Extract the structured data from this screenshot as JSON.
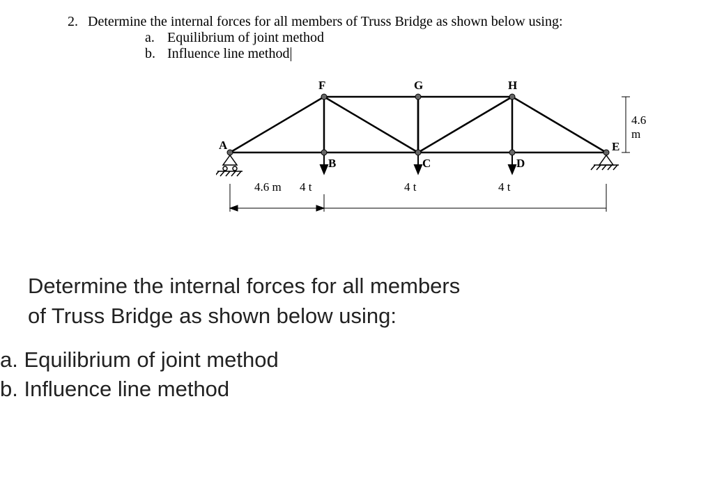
{
  "problem": {
    "number": "2.",
    "text": "Determine the internal forces for all members of Truss Bridge as shown below using:",
    "sub_a_letter": "a.",
    "sub_a_text": "Equilibrium of joint method",
    "sub_b_letter": "b.",
    "sub_b_text": "Influence line method"
  },
  "truss": {
    "nodes": {
      "A": "A",
      "B": "B",
      "C": "C",
      "D": "D",
      "E": "E",
      "F": "F",
      "G": "G",
      "H": "H"
    },
    "right_height": "4.6 m",
    "span_first": "4.6 m",
    "loads": {
      "B": "4 t",
      "C": "4 t",
      "D": "4 t"
    }
  },
  "large": {
    "line1": "Determine the internal forces for all members",
    "line2": "of Truss Bridge as shown below using:",
    "sub_a": "a. Equilibrium of joint method",
    "sub_b": "b. Influence line method"
  }
}
